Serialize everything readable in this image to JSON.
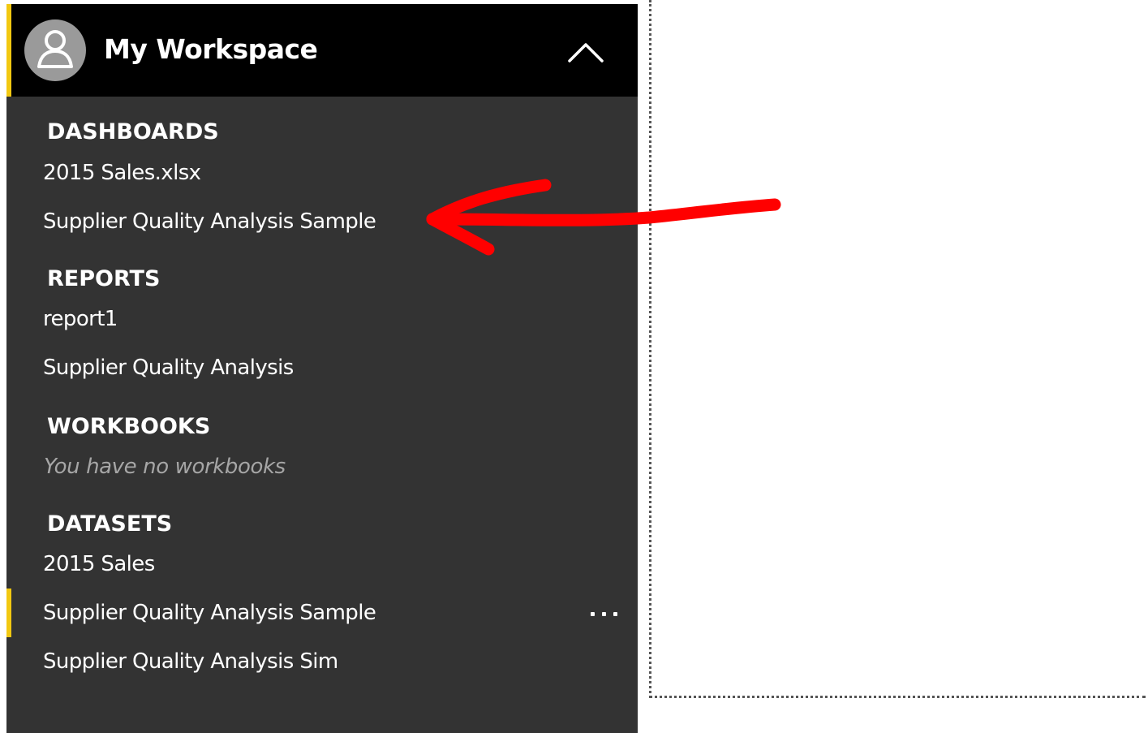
{
  "workspace": {
    "title": "My Workspace",
    "avatar_icon": "person-icon",
    "chevron_icon": "chevron-up-icon",
    "accent_color": "#f2c811"
  },
  "sections": {
    "dashboards": {
      "heading": "DASHBOARDS",
      "items": [
        "2015 Sales.xlsx",
        "Supplier Quality Analysis Sample"
      ]
    },
    "reports": {
      "heading": "REPORTS",
      "items": [
        "report1",
        "Supplier Quality Analysis"
      ]
    },
    "workbooks": {
      "heading": "WORKBOOKS",
      "empty_text": "You have no workbooks"
    },
    "datasets": {
      "heading": "DATASETS",
      "items": [
        "2015 Sales",
        "Supplier Quality Analysis Sample",
        "Supplier Quality Analysis Sim"
      ],
      "more_options_label": "..."
    }
  },
  "annotation": {
    "color": "#ff0000",
    "icon": "red-arrow-annotation"
  },
  "colors": {
    "nav_background": "#333333",
    "header_background": "#000000",
    "muted_text": "#a6a6a6"
  }
}
